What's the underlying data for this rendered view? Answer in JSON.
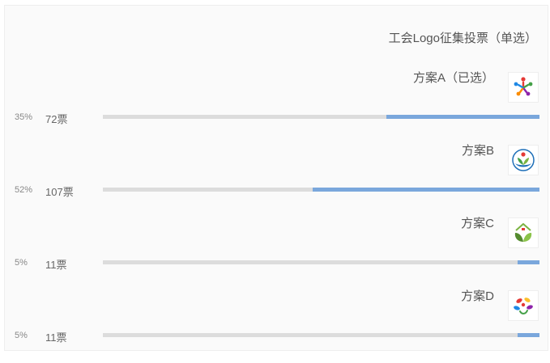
{
  "poll": {
    "title": "工会Logo征集投票（单选）",
    "options": [
      {
        "label": "方案A（已选）",
        "votes": "72票",
        "percent": "35%",
        "fill_fraction": 0.35,
        "icon": "people-logo-icon"
      },
      {
        "label": "方案B",
        "votes": "107票",
        "percent": "52%",
        "fill_fraction": 0.52,
        "icon": "hand-sprout-logo-icon"
      },
      {
        "label": "方案C",
        "votes": "11票",
        "percent": "5%",
        "fill_fraction": 0.05,
        "icon": "house-leaf-logo-icon"
      },
      {
        "label": "方案D",
        "votes": "11票",
        "percent": "5%",
        "fill_fraction": 0.05,
        "icon": "petals-logo-icon"
      }
    ]
  },
  "colors": {
    "bar_fill": "#7aa7dc",
    "bar_track": "#dcdcdc",
    "card_bg": "#fafafa"
  }
}
